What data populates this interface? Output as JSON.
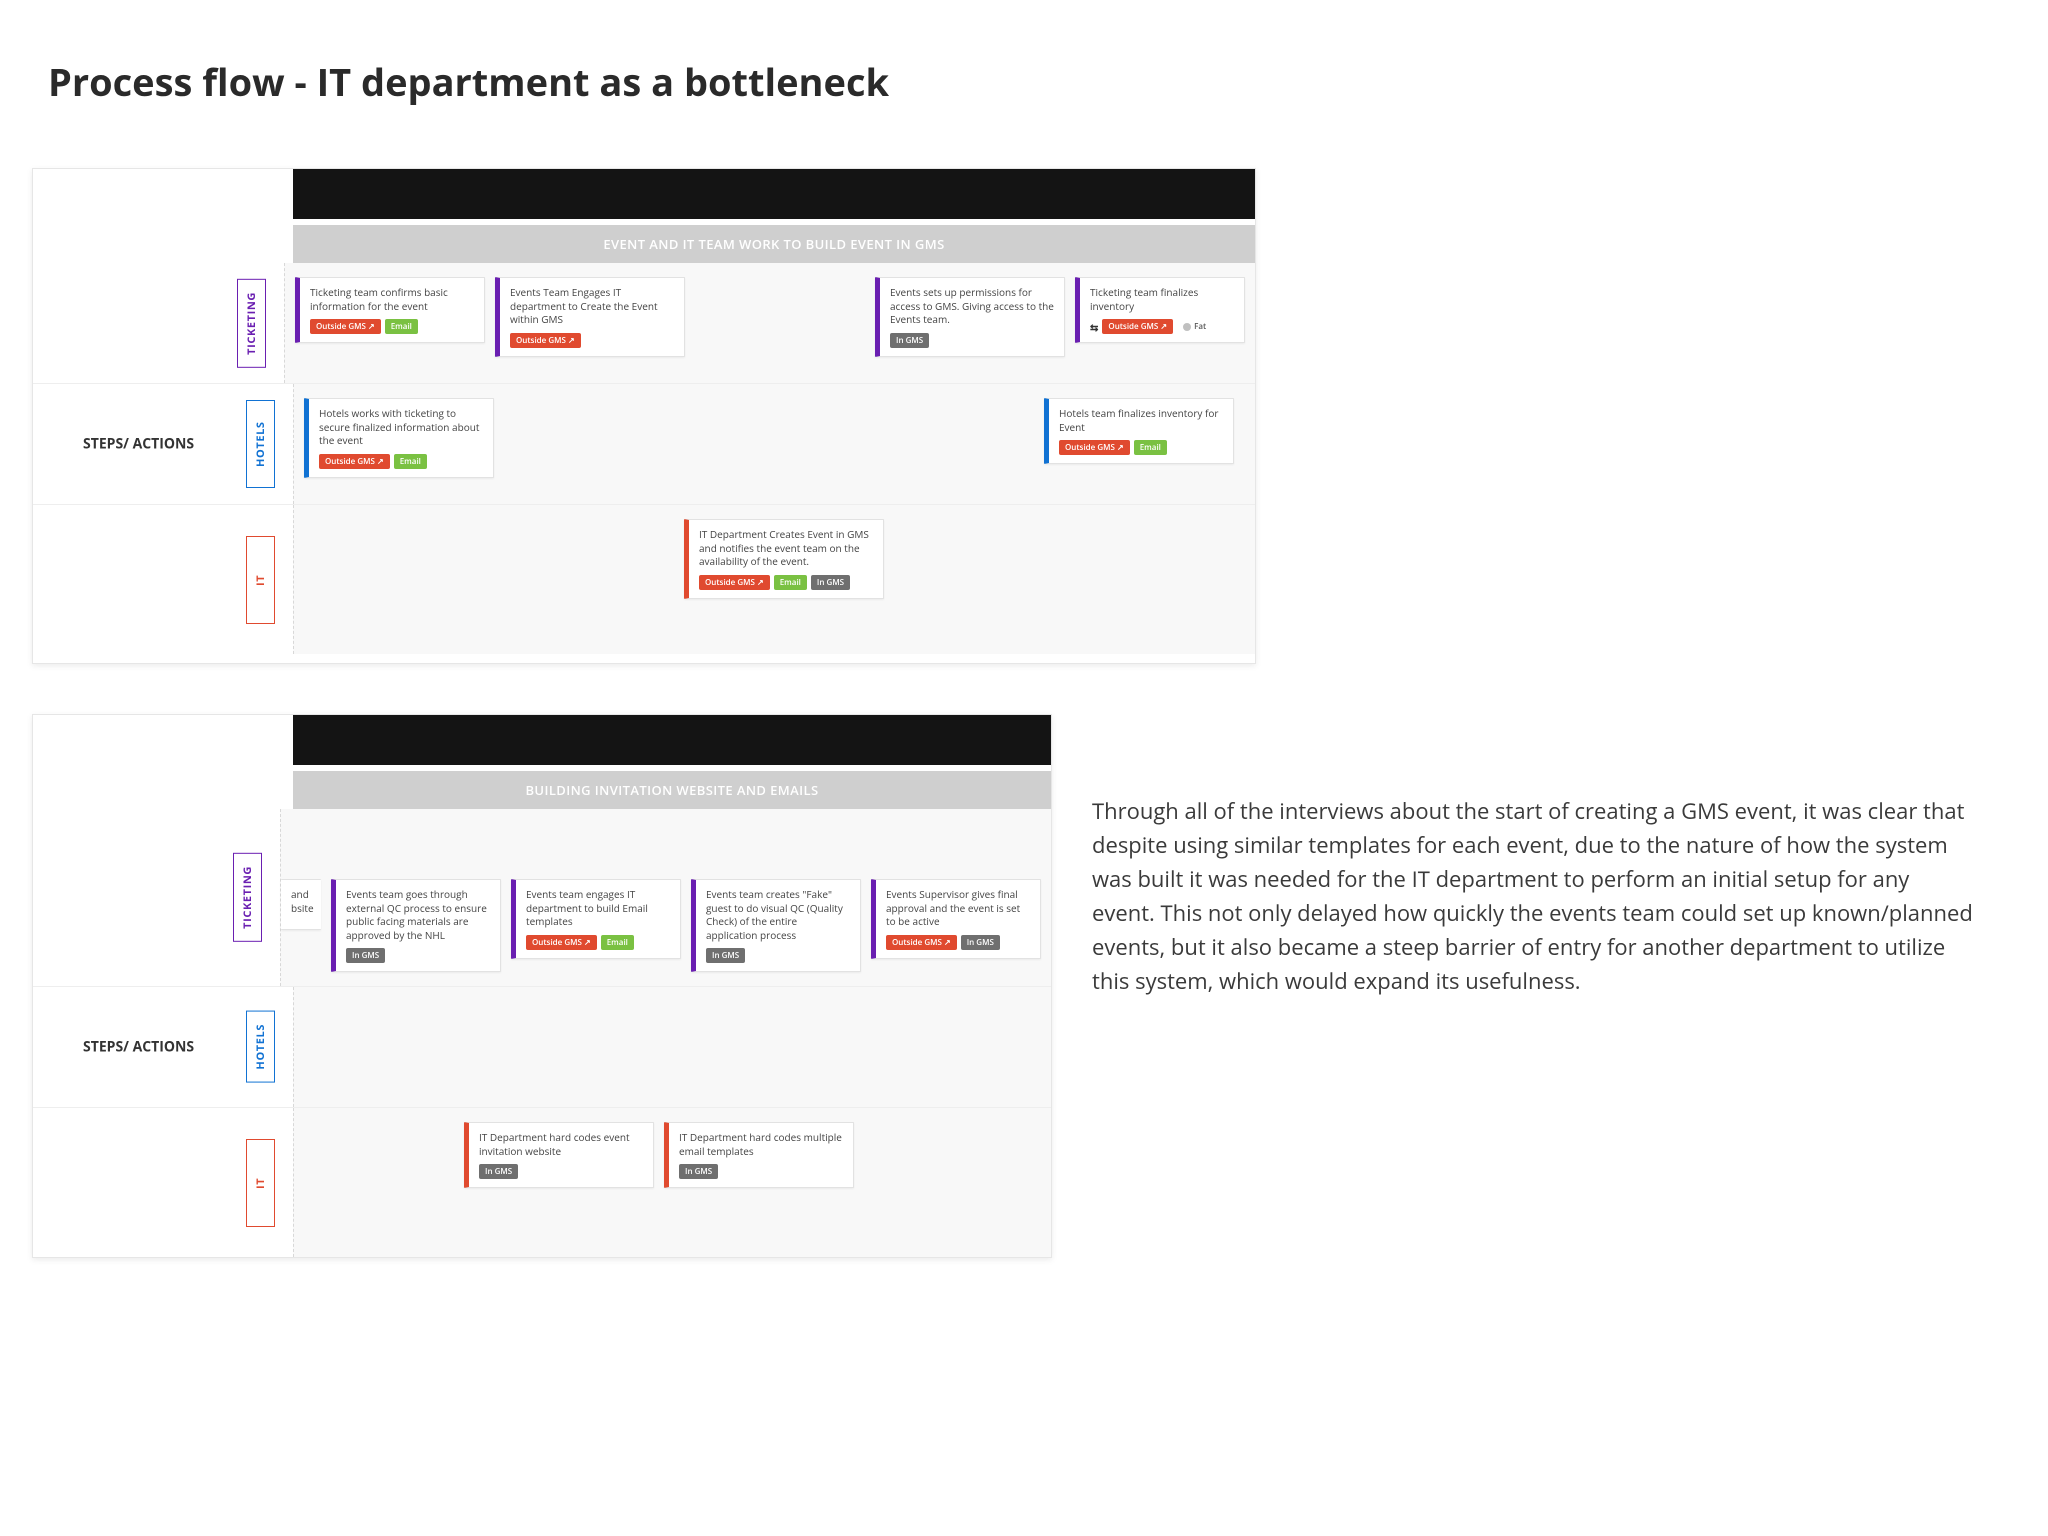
{
  "page": {
    "title": "Process flow - IT department as a bottleneck"
  },
  "labels": {
    "steps": "STEPS/ ACTIONS",
    "ticketing": "TICKETING",
    "hotels": "HOTELS",
    "it": "IT"
  },
  "tags": {
    "outside": "Outside GMS ↗",
    "in": "In GMS",
    "email": "Email",
    "fat": "Fat",
    "filter": "⇆"
  },
  "diagram1": {
    "section": "EVENT AND IT TEAM WORK TO BUILD EVENT IN GMS",
    "ticketing": [
      {
        "text": "Ticketing team confirms basic information for the event",
        "tags": [
          "outside",
          "email"
        ]
      },
      {
        "text": "Events Team Engages IT department to Create the Event within GMS",
        "tags": [
          "outside"
        ]
      },
      {
        "text": "Events sets up permissions for access to GMS. Giving access to the Events team.",
        "tags": [
          "in"
        ]
      },
      {
        "text": "Ticketing team finalizes inventory",
        "tags": [
          "filter",
          "outside",
          "fat"
        ]
      }
    ],
    "hotels": [
      {
        "text": "Hotels works with ticketing to secure finalized information about the event",
        "tags": [
          "outside",
          "email"
        ]
      },
      {
        "text": "Hotels team finalizes inventory for Event",
        "tags": [
          "outside",
          "email"
        ]
      }
    ],
    "it": [
      {
        "text": "IT Department Creates Event in GMS and notifies the event team on the availability of the event.",
        "tags": [
          "outside",
          "email",
          "in"
        ]
      }
    ]
  },
  "diagram2": {
    "section": "BUILDING INVITATION WEBSITE AND EMAILS",
    "ticketing_cutoff": {
      "text": "and bsite"
    },
    "ticketing": [
      {
        "text": "Events team goes through external QC process to ensure public facing materials are approved by the NHL",
        "tags": [
          "in"
        ]
      },
      {
        "text": "Events team engages IT department to build Email templates",
        "tags": [
          "outside",
          "email"
        ]
      },
      {
        "text": "Events team creates \"Fake\" guest to do visual QC  (Quality Check) of the entire application process",
        "tags": [
          "in"
        ]
      },
      {
        "text": "Events Supervisor gives final approval and the event is set to be active",
        "tags": [
          "outside",
          "in"
        ]
      }
    ],
    "it": [
      {
        "text": "IT Department hard codes event invitation website",
        "tags": [
          "in"
        ]
      },
      {
        "text": "IT Department hard codes multiple email templates",
        "tags": [
          "in"
        ]
      }
    ]
  },
  "sidetext": "Through all of the interviews about the start of creating a GMS event, it was clear that despite using similar templates for each event, due to the nature of how the system was built it was needed for the IT department to perform an initial setup for any event.  This not only delayed how quickly the events team could set up known/planned events, but it also became a steep barrier of entry for another department to utilize this system, which would expand its usefulness."
}
